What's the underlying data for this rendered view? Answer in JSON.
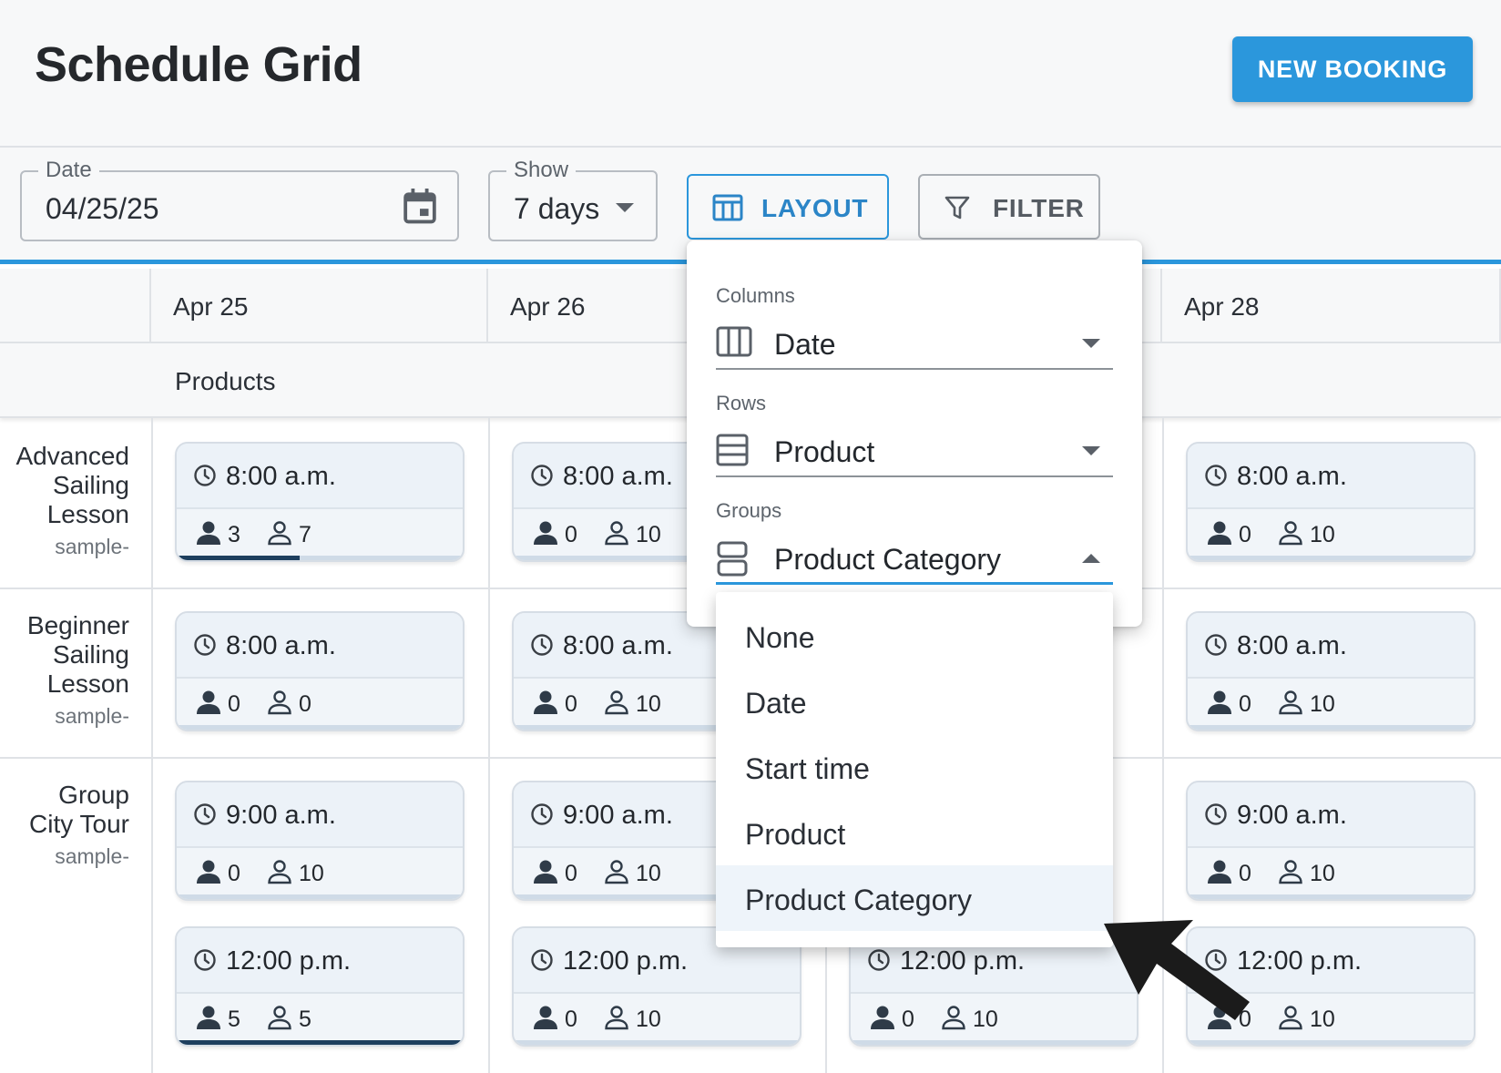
{
  "header": {
    "title": "Schedule Grid",
    "new_booking_label": "NEW BOOKING"
  },
  "toolbar": {
    "date": {
      "label": "Date",
      "value": "04/25/25"
    },
    "show": {
      "label": "Show",
      "value": "7 days"
    },
    "layout_label": "LAYOUT",
    "filter_label": "FILTER"
  },
  "grid": {
    "columns": [
      "Apr 25",
      "Apr 26",
      "Apr 28"
    ],
    "group_label": "Products",
    "rows": [
      {
        "name_lines": [
          "Advanced",
          "Sailing",
          "Lesson"
        ],
        "sub": "sample-"
      },
      {
        "name_lines": [
          "Beginner",
          "Sailing",
          "Lesson"
        ],
        "sub": "sample-"
      },
      {
        "name_lines": [
          "Group",
          "City Tour"
        ],
        "sub": "sample-"
      }
    ],
    "slots": {
      "r0c0": {
        "time": "8:00 a.m.",
        "booked": "3",
        "capacity": "7",
        "fill": 0.43
      },
      "r0c1": {
        "time": "8:00 a.m.",
        "booked": "0",
        "capacity": "10",
        "fill": 0
      },
      "r0c3": {
        "time": "8:00 a.m.",
        "booked": "0",
        "capacity": "10",
        "fill": 0
      },
      "r1c0": {
        "time": "8:00 a.m.",
        "booked": "0",
        "capacity": "0",
        "fill": 0
      },
      "r1c1": {
        "time": "8:00 a.m.",
        "booked": "0",
        "capacity": "10",
        "fill": 0
      },
      "r1c3": {
        "time": "8:00 a.m.",
        "booked": "0",
        "capacity": "10",
        "fill": 0
      },
      "r2c0a": {
        "time": "9:00 a.m.",
        "booked": "0",
        "capacity": "10",
        "fill": 0
      },
      "r2c1a": {
        "time": "9:00 a.m.",
        "booked": "0",
        "capacity": "10",
        "fill": 0
      },
      "r2c3a": {
        "time": "9:00 a.m.",
        "booked": "0",
        "capacity": "10",
        "fill": 0
      },
      "r2c0b": {
        "time": "12:00 p.m.",
        "booked": "5",
        "capacity": "5",
        "fill": 1.0
      },
      "r2c1b": {
        "time": "12:00 p.m.",
        "booked": "0",
        "capacity": "10",
        "fill": 0
      },
      "r2c2b": {
        "time": "12:00 p.m.",
        "booked": "0",
        "capacity": "10",
        "fill": 0
      },
      "r2c3b": {
        "time": "12:00 p.m.",
        "booked": "0",
        "capacity": "10",
        "fill": 0
      }
    }
  },
  "layout_panel": {
    "columns": {
      "label": "Columns",
      "value": "Date",
      "icon": "columns-icon"
    },
    "rows": {
      "label": "Rows",
      "value": "Product",
      "icon": "rows-icon"
    },
    "groups": {
      "label": "Groups",
      "value": "Product Category",
      "icon": "groups-icon"
    }
  },
  "groups_menu": {
    "options": [
      "None",
      "Date",
      "Start time",
      "Product",
      "Product Category"
    ],
    "selected": "Product Category"
  },
  "colors": {
    "accent": "#2b97dc",
    "progress": "#1e3f5e"
  }
}
